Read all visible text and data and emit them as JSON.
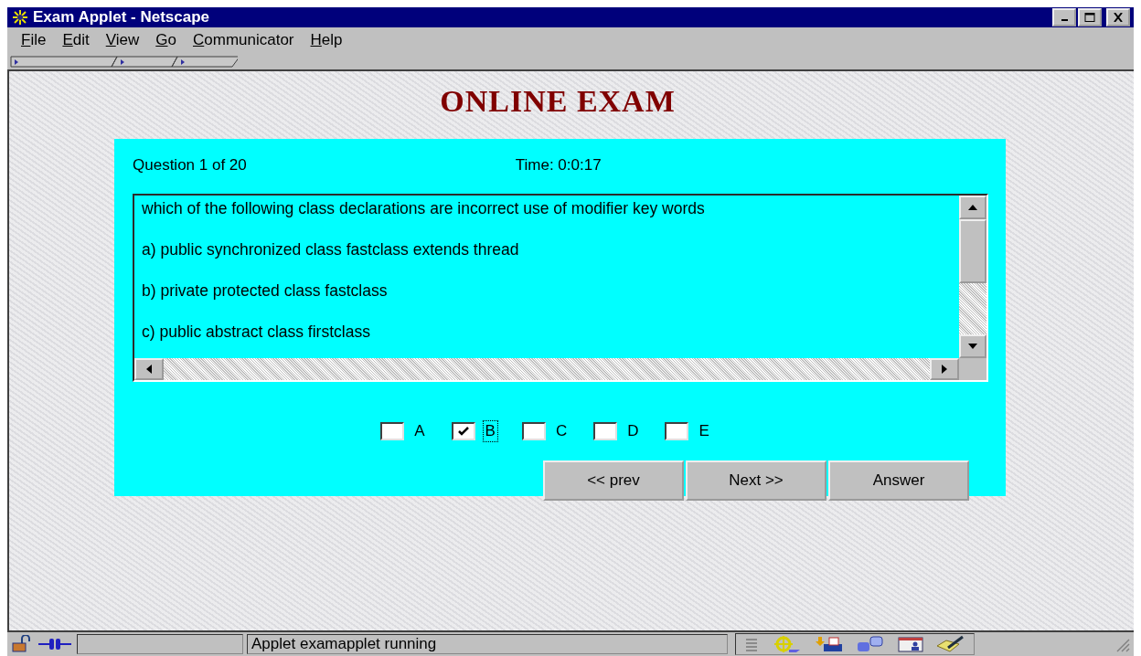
{
  "window": {
    "title": "Exam Applet - Netscape"
  },
  "menu": [
    "File",
    "Edit",
    "View",
    "Go",
    "Communicator",
    "Help"
  ],
  "page": {
    "heading": "ONLINE EXAM",
    "question_counter": "Question 1 of 20",
    "timer": "Time:  0:0:17",
    "question_lines": [
      "which of the following class declarations are incorrect use of modifier key words",
      "a)  public synchronized class fastclass extends thread",
      "b)  private protected class fastclass",
      "c)  public abstract class firstclass"
    ],
    "options": [
      {
        "label": "A",
        "checked": false,
        "focused": false
      },
      {
        "label": "B",
        "checked": true,
        "focused": true
      },
      {
        "label": "C",
        "checked": false,
        "focused": false
      },
      {
        "label": "D",
        "checked": false,
        "focused": false
      },
      {
        "label": "E",
        "checked": false,
        "focused": false
      }
    ],
    "buttons": [
      "<< prev",
      "Next >>",
      "Answer"
    ]
  },
  "status_bar": {
    "message": "Applet examapplet running"
  }
}
